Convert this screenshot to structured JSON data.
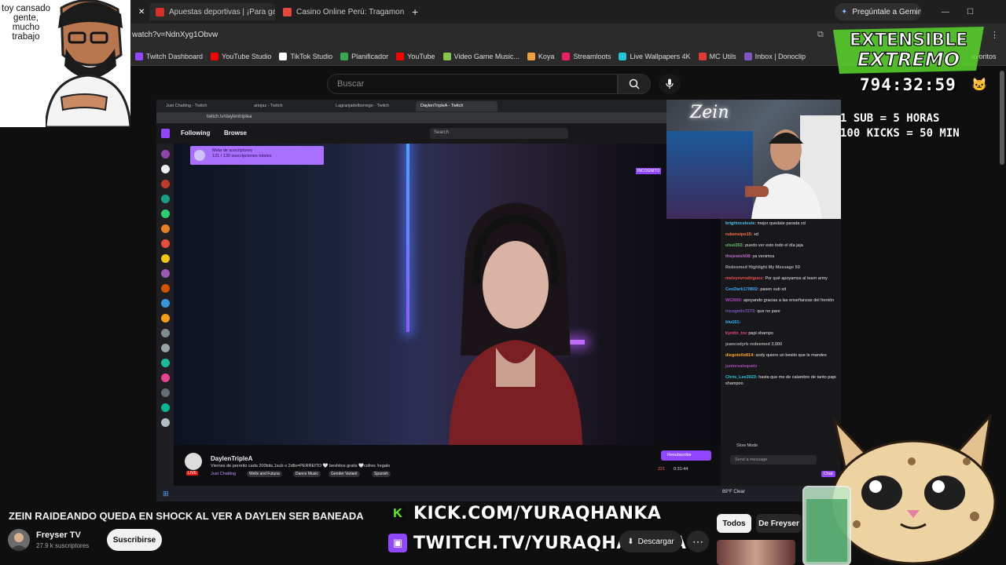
{
  "meme": {
    "caption": "toy cansado gente, mucho trabajo"
  },
  "browser": {
    "tabs": [
      {
        "title": "Apuestas deportivas | ¡Para gar",
        "color": "#d93025"
      },
      {
        "title": "Casino Online Perú: Tragamone",
        "color": "#e8453c"
      }
    ],
    "new_tab": "+",
    "gemini_button": "Pregúntale a Gemini",
    "url": "watch?v=NdnXyg1Obvw",
    "bookmarks": [
      {
        "label": "Twitch Dashboard",
        "color": "#9146ff"
      },
      {
        "label": "YouTube Studio",
        "color": "#ff0000"
      },
      {
        "label": "TikTok Studio",
        "color": "#ffffff"
      },
      {
        "label": "Planificador",
        "color": "#34a853"
      },
      {
        "label": "YouTube",
        "color": "#ff0000"
      },
      {
        "label": "Video Game Music...",
        "color": "#8bc34a"
      },
      {
        "label": "Koya",
        "color": "#f0a040"
      },
      {
        "label": "Streamloots",
        "color": "#e91e63"
      },
      {
        "label": "Live Wallpapers 4K",
        "color": "#26c6da"
      },
      {
        "label": "MC Utils",
        "color": "#e53935"
      },
      {
        "label": "Inbox | Donoclip",
        "color": "#7e57c2"
      }
    ],
    "favorites_label": "avoritos"
  },
  "youtube": {
    "search_placeholder": "Buscar",
    "video_title": "ZEIN RAIDEANDO QUEDA EN SHOCK AL VER A DAYLEN SER BANEADA",
    "channel_name": "Freyser TV",
    "subscribers": "27.9 k suscriptores",
    "subscribe_label": "Suscribirse",
    "download_label": "Descargar",
    "chips": [
      "Todos",
      "De Freyser"
    ]
  },
  "overlay": {
    "logo_line1": "EXTENSIBLE",
    "logo_line2": "EXTREMO",
    "timer": "794:32:59",
    "rules": [
      "1 SUB = 5 HORAS",
      "100 KICKS = 50 MIN"
    ],
    "kick_url": "KICK.COM/YURAQHANKA",
    "twitch_url": "TWITCH.TV/YURAQHANKAA"
  },
  "webcam": {
    "neon_sign": "Zein"
  },
  "inner": {
    "tabs": [
      "Just Chatting - Twitch",
      "ariojaz - Twitch",
      "Lagranjadelborrego - Twitch",
      "DaylenTripleA - Twitch"
    ],
    "url": "twitch.tv/daylentriplea",
    "nav_following": "Following",
    "nav_browse": "Browse",
    "search_placeholder": "Search",
    "sub_goal_title": "Meta de suscriptores",
    "sub_goal_progress": "131 / 130 suscripciones totales",
    "incognito_label": "INCOGNITO",
    "streamer": "DaylenTripleA",
    "stream_title": "Viernes de perreito cada 200bits,1sub o 2dils=PERREITO 🤍 beshitos gratis 🤍cofres !regalo",
    "category": "Just Chatting",
    "tags": [
      "Wells and Futuna",
      "Dance Music",
      "Gender Variant",
      "Spanish"
    ],
    "resubscribe_label": "Resubscribe",
    "viewers": "221",
    "uptime": "0:31:44",
    "chat_input": "Send a message",
    "chat_button": "Chat",
    "slow_mode": "Slow Mode",
    "weather": "89°F Clear",
    "chat": [
      {
        "user": "brightxceleste:",
        "msg": "mejor quedate parada xd",
        "color": "#4fc3f7"
      },
      {
        "user": "rubensipo15:",
        "msg": "xd",
        "color": "#ff7043"
      },
      {
        "user": "ulsel303:",
        "msg": "puedo ver esto todo el día jaja",
        "color": "#66bb6a"
      },
      {
        "user": "thejewish08:",
        "msg": "ya venimos",
        "color": "#ba68c8"
      },
      {
        "user": "Redeemed Highlight My Message",
        "msg": "50",
        "color": "#aaaaaa"
      },
      {
        "user": "melvynvrodriguez:",
        "msg": "Por qué apoyamos al team army",
        "color": "#ef5350"
      },
      {
        "user": "CeoDark170802:",
        "msg": "pasen sub xd",
        "color": "#42a5f5"
      },
      {
        "user": "WGN60:",
        "msg": "apoyando gracias a las enseñanzas del frentón",
        "color": "#ab47bc"
      },
      {
        "user": "incognito7273:",
        "msg": "que no pare",
        "color": "#7e57c2"
      },
      {
        "user": "blu161:",
        "msg": "",
        "color": "#29b6f6"
      },
      {
        "user": "kyotto_tnc",
        "msg": "papi shampo",
        "color": "#ec407a"
      },
      {
        "user": "jeancodyrb redeemed",
        "msg": "3,000",
        "color": "#aaaaaa"
      },
      {
        "user": "diegotello814:",
        "msg": "andy quiere un besito que le mandes",
        "color": "#ffa726"
      },
      {
        "user": "juniorsaisquetz",
        "msg": "",
        "color": "#ab47bc"
      },
      {
        "user": "Chris_Lee2023:",
        "msg": "hasta que me de calambre de tanto papi shampoo",
        "color": "#26c6da"
      }
    ]
  },
  "colors": {
    "twitch_purple": "#9146ff",
    "kick_green": "#53fc18",
    "logo_green": "#7cff2e"
  }
}
